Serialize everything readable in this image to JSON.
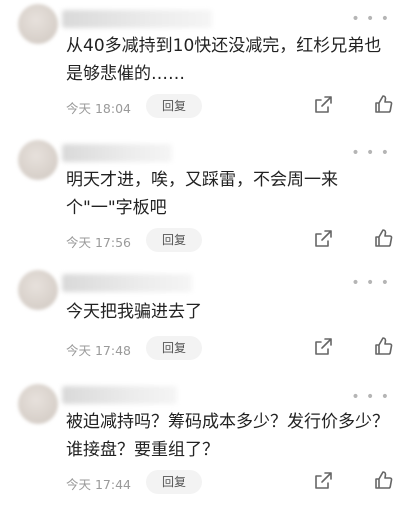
{
  "comments": [
    {
      "text": "从40多减持到10快还没减完，红杉兄弟也是够悲催的……",
      "time": "今天 18:04",
      "reply_label": "回复",
      "more_icon": "more-dots-icon"
    },
    {
      "text": "明天才进，唉，又踩雷，不会周一来\n个\"一\"字板吧",
      "time": "今天 17:56",
      "reply_label": "回复",
      "more_icon": "more-dots-icon"
    },
    {
      "text": "今天把我骗进去了",
      "time": "今天 17:48",
      "reply_label": "回复",
      "more_icon": "more-dots-icon"
    },
    {
      "text": "被迫减持吗？筹码成本多少？发行价多少？谁接盘？要重组了？",
      "time": "今天 17:44",
      "reply_label": "回复",
      "more_icon": "more-dots-icon"
    }
  ],
  "icons": {
    "share": "share-icon",
    "like": "thumbs-up-icon"
  },
  "colors": {
    "text": "#222222",
    "meta": "#9a9a9a",
    "reply_bg": "#f3f3f3"
  }
}
